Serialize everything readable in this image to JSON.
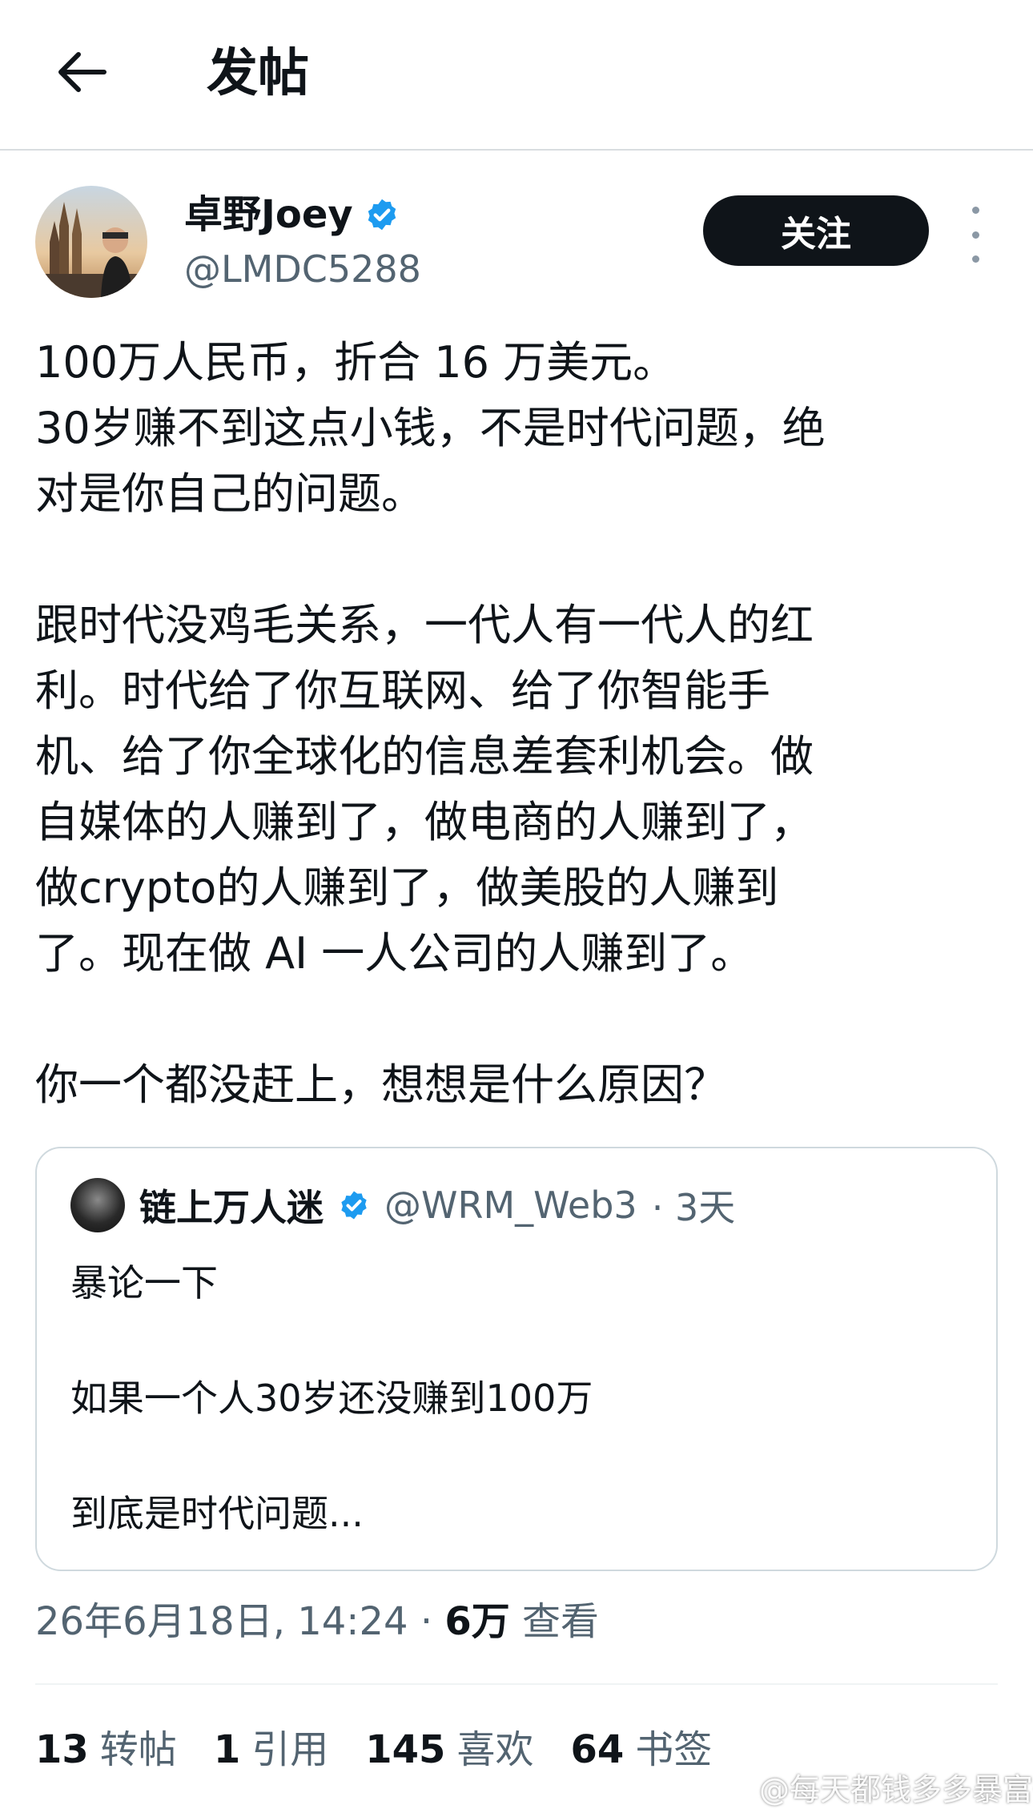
{
  "header": {
    "title": "发帖",
    "back_icon": "arrow-left-icon"
  },
  "author": {
    "name": "卓野Joey",
    "handle": "@LMDC5288",
    "verified_color": "#1d9bf0",
    "follow_label": "关注"
  },
  "post": {
    "lines_1": [
      "100万人民币，折合 16 万美元。",
      "30岁赚不到这点小钱，不是时代问题，绝",
      "对是你自己的问题。"
    ],
    "lines_2": [
      "跟时代没鸡毛关系，一代人有一代人的红",
      "利。时代给了你互联网、给了你智能手",
      "机、给了你全球化的信息差套利机会。做",
      "自媒体的人赚到了，做电商的人赚到了，",
      "做crypto的人赚到了，做美股的人赚到",
      "了。现在做 AI 一人公司的人赚到了。"
    ],
    "lines_3": [
      "你一个都没赶上，想想是什么原因？"
    ]
  },
  "quote": {
    "name": "链上万人迷",
    "handle": "@WRM_Web3",
    "time": "· 3天",
    "line_1": "暴论一下",
    "line_2": "如果一个人30岁还没赚到100万",
    "line_3": "到底是时代问题..."
  },
  "meta": {
    "datetime": "26年6月18日, 14:24",
    "sep": "·",
    "views_count": "6万",
    "views_label": "查看"
  },
  "stats": [
    {
      "count": "13",
      "label": "转帖"
    },
    {
      "count": "1",
      "label": "引用"
    },
    {
      "count": "145",
      "label": "喜欢"
    },
    {
      "count": "64",
      "label": "书签"
    }
  ],
  "watermark": "@每天都钱多多暴富鹤"
}
